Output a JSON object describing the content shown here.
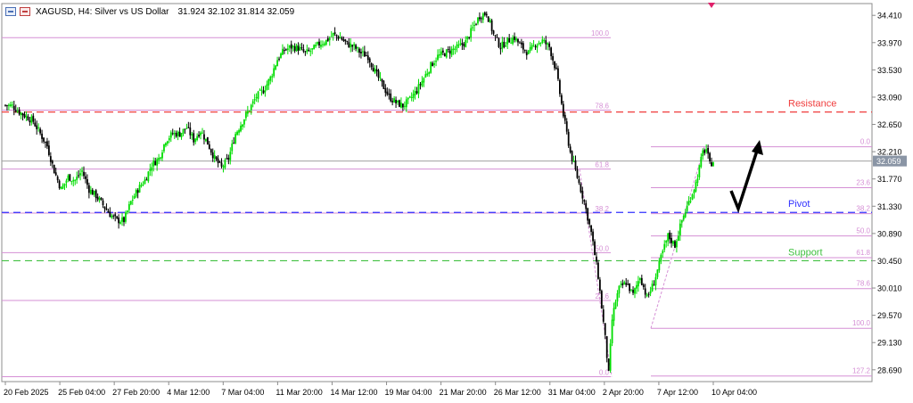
{
  "header": {
    "symbol": "XAGUSD, H4:  Silver vs US Dollar",
    "ohlc": "31.924 32.102 31.814 32.059"
  },
  "colors": {
    "bull": "#00dd00",
    "bear": "#000000",
    "resistance": "#f03c3c",
    "pivot": "#3232ff",
    "support": "#40c040",
    "fib": "#d58fd5",
    "price_line": "#a0a0a0",
    "price_badge": "#8a95a5"
  },
  "chart_data": {
    "type": "candlestick",
    "ylim": [
      28.5,
      34.6
    ],
    "yticks": [
      "34.410",
      "33.970",
      "33.530",
      "33.090",
      "32.650",
      "32.210",
      "31.770",
      "31.330",
      "30.890",
      "30.450",
      "30.010",
      "29.570",
      "29.130",
      "28.690"
    ],
    "xticks": [
      "20 Feb 2025",
      "25 Feb 04:00",
      "27 Feb 20:00",
      "4 Mar 12:00",
      "7 Mar 04:00",
      "11 Mar 20:00",
      "14 Mar 12:00",
      "19 Mar 04:00",
      "21 Mar 20:00",
      "26 Mar 12:00",
      "31 Mar 04:00",
      "2 Apr 20:00",
      "7 Apr 12:00",
      "10 Apr 04:00"
    ],
    "current_price": "32.059",
    "levels": [
      {
        "label": "Resistance",
        "price": 32.85,
        "color": "resistance"
      },
      {
        "label": "Pivot",
        "price": 31.23,
        "color": "pivot"
      },
      {
        "label": "Support",
        "price": 30.45,
        "color": "support"
      }
    ],
    "fib_left": [
      {
        "label": "100.0",
        "price": 34.05
      },
      {
        "label": "78.6",
        "price": 32.88
      },
      {
        "label": "61.8",
        "price": 31.93
      },
      {
        "label": "38.2",
        "price": 31.22
      },
      {
        "label": "50.0",
        "price": 30.58
      },
      {
        "label": "23.6",
        "price": 29.81
      },
      {
        "label": "0.0",
        "price": 28.58
      }
    ],
    "fib_right": [
      {
        "label": "0.0",
        "price": 32.29
      },
      {
        "label": "23.6",
        "price": 31.63
      },
      {
        "label": "38.2",
        "price": 31.21
      },
      {
        "label": "50.0",
        "price": 30.85
      },
      {
        "label": "61.8",
        "price": 30.5
      },
      {
        "label": "78.6",
        "price": 30.0
      },
      {
        "label": "100.0",
        "price": 29.36
      },
      {
        "label": "127.2",
        "price": 28.59
      }
    ],
    "close_path": [
      [
        0,
        32.96
      ],
      [
        4,
        32.95
      ],
      [
        8,
        32.85
      ],
      [
        12,
        32.78
      ],
      [
        16,
        32.7
      ],
      [
        20,
        32.5
      ],
      [
        24,
        32.3
      ],
      [
        28,
        31.9
      ],
      [
        32,
        31.6
      ],
      [
        36,
        31.8
      ],
      [
        40,
        31.75
      ],
      [
        44,
        31.9
      ],
      [
        48,
        31.6
      ],
      [
        52,
        31.5
      ],
      [
        56,
        31.35
      ],
      [
        60,
        31.2
      ],
      [
        64,
        31.1
      ],
      [
        68,
        31.1
      ],
      [
        72,
        31.4
      ],
      [
        76,
        31.6
      ],
      [
        80,
        31.75
      ],
      [
        84,
        32.0
      ],
      [
        88,
        32.1
      ],
      [
        92,
        32.4
      ],
      [
        96,
        32.5
      ],
      [
        100,
        32.5
      ],
      [
        104,
        32.6
      ],
      [
        108,
        32.4
      ],
      [
        112,
        32.55
      ],
      [
        116,
        32.35
      ],
      [
        120,
        32.1
      ],
      [
        124,
        31.95
      ],
      [
        128,
        32.1
      ],
      [
        132,
        32.5
      ],
      [
        136,
        32.7
      ],
      [
        140,
        32.9
      ],
      [
        144,
        33.1
      ],
      [
        148,
        33.2
      ],
      [
        152,
        33.4
      ],
      [
        156,
        33.7
      ],
      [
        160,
        33.85
      ],
      [
        164,
        33.9
      ],
      [
        168,
        33.88
      ],
      [
        172,
        33.8
      ],
      [
        176,
        33.85
      ],
      [
        180,
        33.95
      ],
      [
        184,
        34.0
      ],
      [
        188,
        34.1
      ],
      [
        192,
        34.05
      ],
      [
        196,
        33.95
      ],
      [
        200,
        33.9
      ],
      [
        204,
        33.8
      ],
      [
        208,
        33.75
      ],
      [
        212,
        33.5
      ],
      [
        216,
        33.3
      ],
      [
        220,
        33.1
      ],
      [
        224,
        33.0
      ],
      [
        228,
        32.95
      ],
      [
        232,
        33.05
      ],
      [
        236,
        33.2
      ],
      [
        240,
        33.4
      ],
      [
        244,
        33.6
      ],
      [
        248,
        33.75
      ],
      [
        252,
        33.8
      ],
      [
        256,
        33.85
      ],
      [
        260,
        33.9
      ],
      [
        264,
        33.98
      ],
      [
        268,
        34.2
      ],
      [
        272,
        34.4
      ],
      [
        276,
        34.45
      ],
      [
        280,
        34.1
      ],
      [
        284,
        33.9
      ],
      [
        288,
        34.0
      ],
      [
        292,
        34.05
      ],
      [
        296,
        33.9
      ],
      [
        300,
        33.8
      ],
      [
        304,
        33.95
      ],
      [
        308,
        34.0
      ],
      [
        312,
        33.9
      ],
      [
        316,
        33.5
      ],
      [
        320,
        32.8
      ],
      [
        324,
        32.2
      ],
      [
        328,
        31.8
      ],
      [
        332,
        31.4
      ],
      [
        336,
        30.9
      ],
      [
        340,
        30.2
      ],
      [
        344,
        29.2
      ],
      [
        346,
        28.62
      ],
      [
        348,
        29.5
      ],
      [
        350,
        29.8
      ],
      [
        352,
        30.0
      ],
      [
        356,
        30.1
      ],
      [
        360,
        29.9
      ],
      [
        364,
        30.2
      ],
      [
        368,
        29.85
      ],
      [
        372,
        30.1
      ],
      [
        376,
        30.5
      ],
      [
        380,
        30.85
      ],
      [
        384,
        30.7
      ],
      [
        388,
        31.1
      ],
      [
        392,
        31.4
      ],
      [
        396,
        31.7
      ],
      [
        400,
        32.2
      ],
      [
        402,
        32.25
      ],
      [
        404,
        32.0
      ],
      [
        406,
        32.06
      ]
    ]
  }
}
